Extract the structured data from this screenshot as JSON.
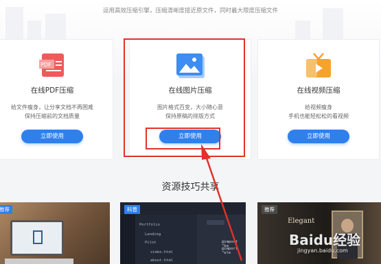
{
  "header": {
    "subtitle": "运用高效压缩引擎，压缩清晰度接近原文件，同时最大限度压缩文件"
  },
  "cards": [
    {
      "title": "在线PDF压缩",
      "desc_lines": [
        "给文件瘦身，让分享文档不再困难",
        "保持压缩前的文档质量"
      ],
      "button": "立即使用",
      "icon": "pdf-icon",
      "icon_text": "PDF"
    },
    {
      "title": "在线图片压缩",
      "desc_lines": [
        "图片格式百变，大小随心意",
        "保持原稿的排版方式"
      ],
      "button": "立即使用",
      "icon": "image-icon"
    },
    {
      "title": "在线视频压缩",
      "desc_lines": [
        "给视频瘦身",
        "手机也能轻松松的看视频"
      ],
      "button": "立即使用",
      "icon": "tv-icon"
    }
  ],
  "section": {
    "title": "资源技巧共享"
  },
  "thumbnails": [
    {
      "tag": "推荐"
    },
    {
      "tag": "科普",
      "tree": [
        "Portfolio",
        "Landing",
        "Pilot",
        "video.html",
        "about.html"
      ],
      "code": [
        "@import \"ba",
        "@import \"ele"
      ]
    },
    {
      "tag": "推荐",
      "cover_title": "Elegant"
    }
  ],
  "watermark": {
    "line1": "Baidu经验",
    "line2": "jingyan.baidu.com"
  },
  "colors": {
    "accent": "#2f80ed",
    "highlight": "#e0312a",
    "pdf": "#f05a5a",
    "image": "#3d8ef0",
    "video": "#f5a32b"
  }
}
